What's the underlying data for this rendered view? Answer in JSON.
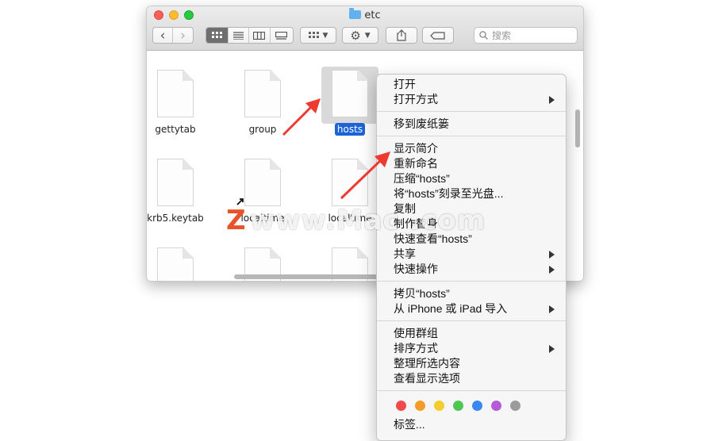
{
  "window": {
    "title": "etc"
  },
  "toolbar": {
    "back": "‹",
    "forward": "›",
    "views": [
      "icon-view",
      "list-view",
      "column-view",
      "gallery-view"
    ],
    "group_icon": "grid-icon",
    "action_icon": "gear-icon",
    "search_placeholder": "搜索"
  },
  "files": [
    {
      "name": "gettytab"
    },
    {
      "name": "group"
    },
    {
      "name": "hosts"
    },
    {
      "name": "krb5.keytab"
    },
    {
      "name": "localtime"
    },
    {
      "name": "localtime"
    }
  ],
  "context_menu": {
    "sections": [
      [
        "打开",
        "打开方式"
      ],
      [
        "移到废纸篓"
      ],
      [
        "显示简介",
        "重新命名",
        "压缩“hosts”",
        "将“hosts”刻录至光盘...",
        "复制",
        "制作替身",
        "快速查看“hosts”",
        "共享",
        "快速操作"
      ],
      [
        "拷贝“hosts”",
        "从 iPhone 或 iPad 导入"
      ],
      [
        "使用群组",
        "排序方式",
        "整理所选内容",
        "查看显示选项"
      ]
    ],
    "tags_label": "标签...",
    "tag_colors": [
      "#ef4b4b",
      "#f39c26",
      "#f4cc2d",
      "#4ec752",
      "#3a87f0",
      "#b45bd6",
      "#9b9b9b"
    ]
  },
  "watermark": {
    "letter": "Z",
    "text": "www.Mac .com"
  }
}
